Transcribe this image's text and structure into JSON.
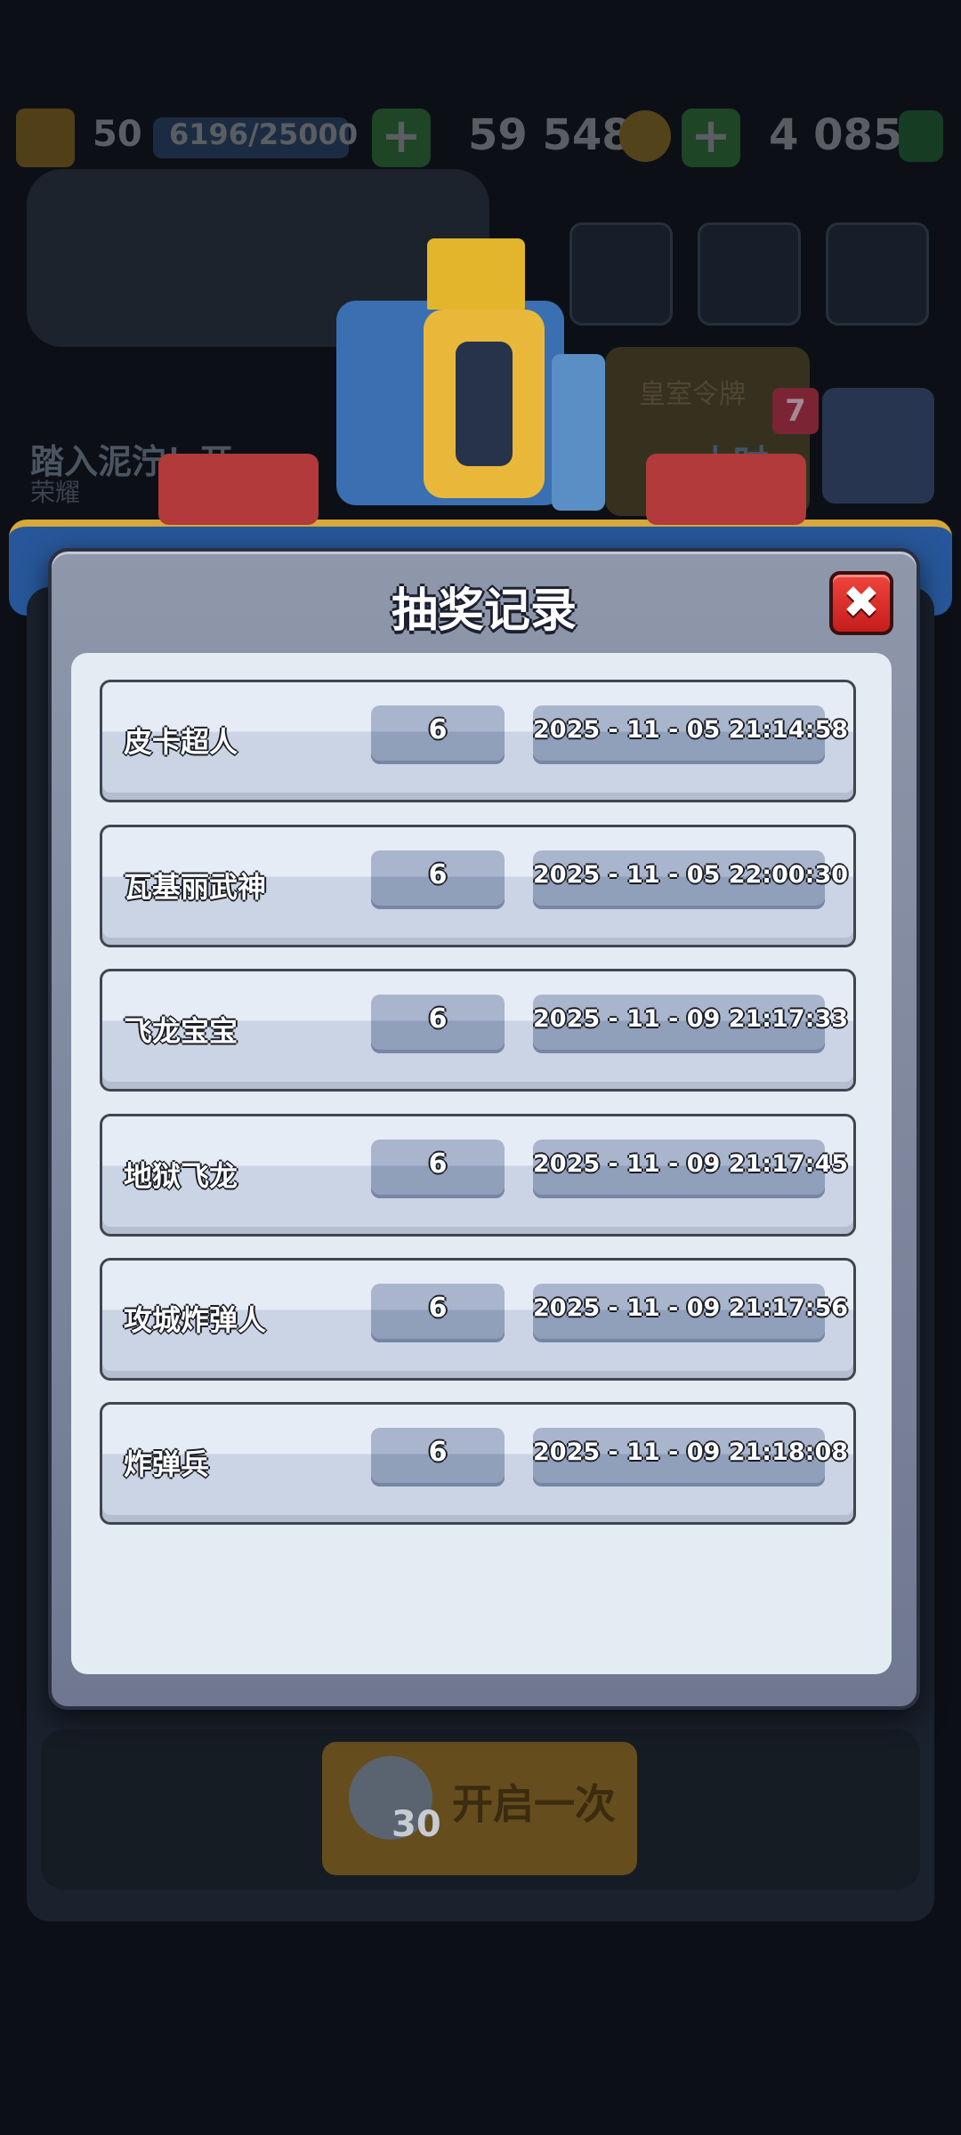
{
  "background": {
    "level": "50",
    "xp": "6196/25000",
    "gold": "59 548",
    "gems": "4 085",
    "banner_title": "踏入泥泞！开...",
    "banner_subtitle": "荣耀",
    "royal_label": "皇室令牌",
    "timer": "...小时",
    "badge_count": "7",
    "open_once": "开启一次",
    "open_cost": "30"
  },
  "dialog": {
    "title": "抽奖记录",
    "close_label": "✖",
    "records": [
      {
        "name": "皮卡超人",
        "count": "6",
        "time": "2025 - 11 - 05  21:14:58"
      },
      {
        "name": "瓦基丽武神",
        "count": "6",
        "time": "2025 - 11 - 05  22:00:30"
      },
      {
        "name": "飞龙宝宝",
        "count": "6",
        "time": "2025 - 11 - 09  21:17:33"
      },
      {
        "name": "地狱飞龙",
        "count": "6",
        "time": "2025 - 11 - 09  21:17:45"
      },
      {
        "name": "攻城炸弹人",
        "count": "6",
        "time": "2025 - 11 - 09  21:17:56"
      },
      {
        "name": "炸弹兵",
        "count": "6",
        "time": "2025 - 11 - 09  21:18:08"
      }
    ]
  }
}
